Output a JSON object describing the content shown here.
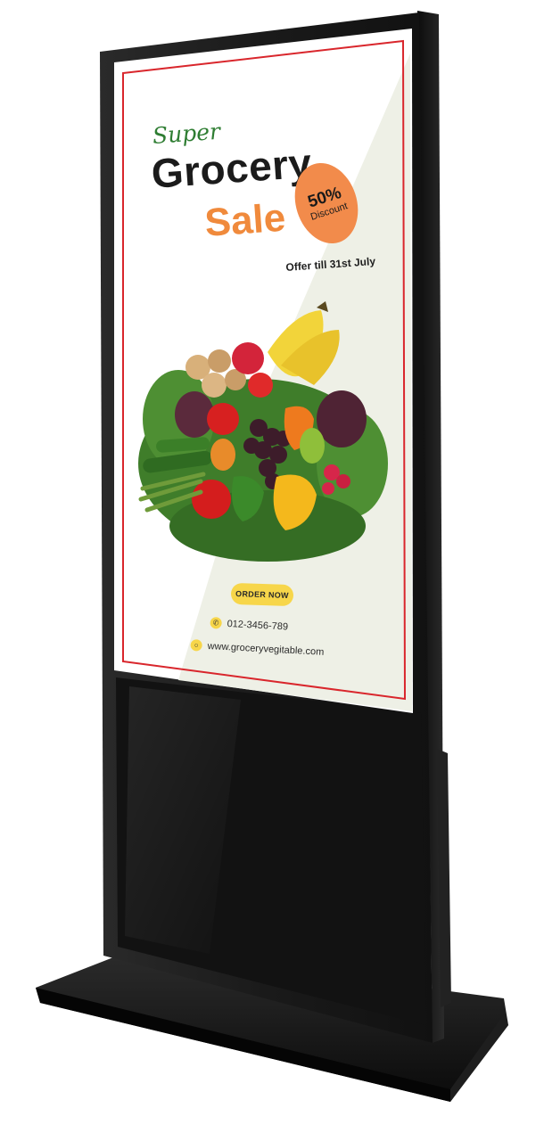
{
  "poster": {
    "super": "Super",
    "title": "Grocery",
    "subtitle": "Sale",
    "badge_percent": "50%",
    "badge_label": "Discount",
    "offer": "Offer till 31st July",
    "order_button": "ORDER NOW",
    "phone": "012-3456-789",
    "website": "www.groceryvegitable.com"
  },
  "colors": {
    "frame": "#1c1c1c",
    "poster_background": "#ffffff",
    "poster_diagonal": "#eef0e6",
    "border_line": "#d9262c",
    "sale_orange": "#f08a3c",
    "badge_orange": "#f28b4b",
    "button_yellow": "#f7d64a",
    "super_green": "#2e7d32"
  },
  "icons": [
    "phone-icon",
    "globe-icon"
  ]
}
